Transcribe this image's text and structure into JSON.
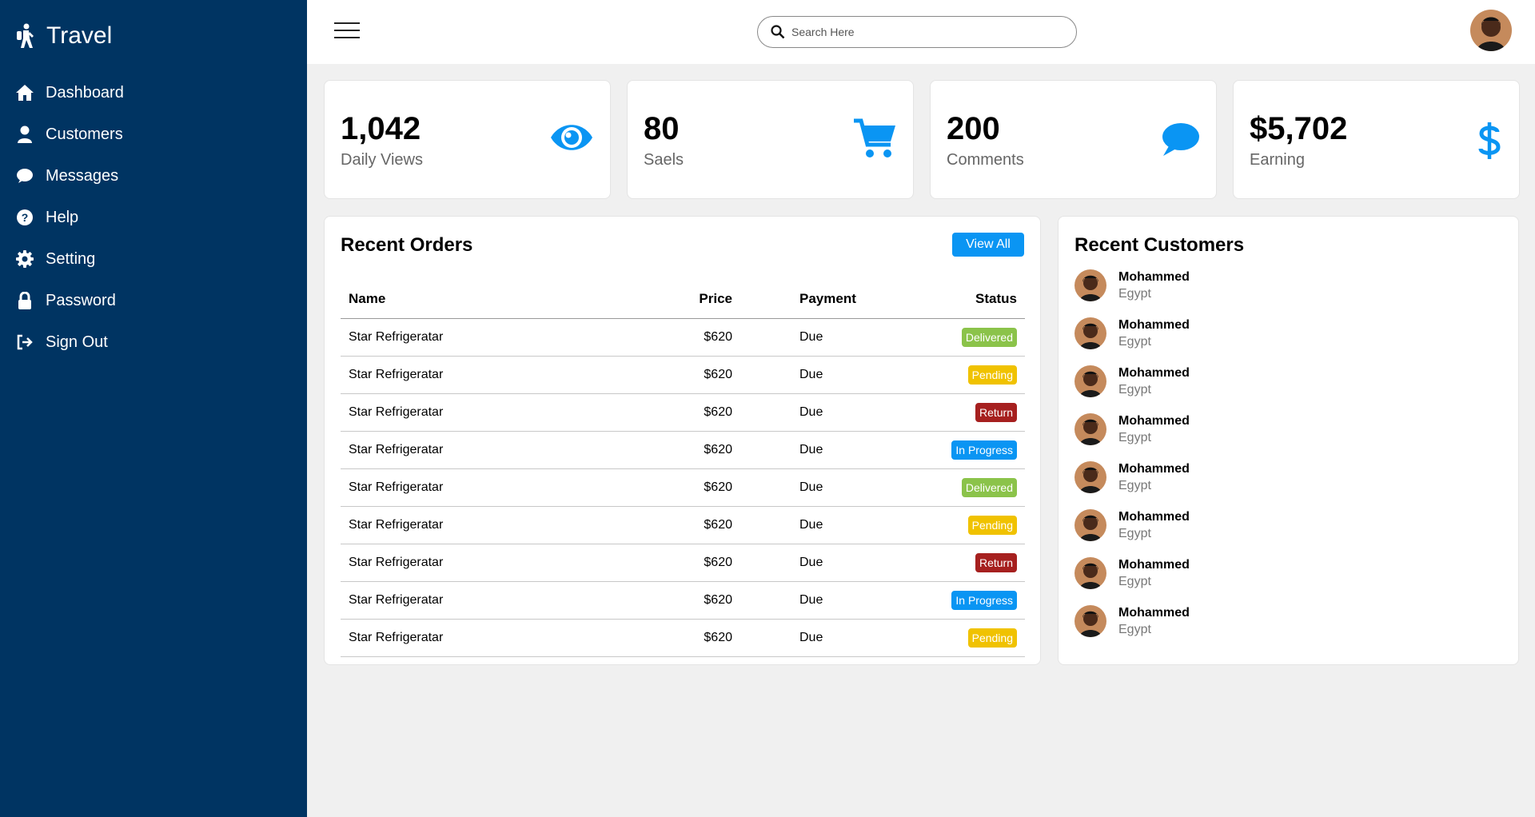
{
  "colors": {
    "sidebar_bg": "#003462",
    "accent": "#0a95f3",
    "delivered": "#8bc34a",
    "pending": "#f0c200",
    "return": "#a6201f",
    "in_progress": "#0a95f3"
  },
  "sidebar": {
    "brand": {
      "title": "Travel",
      "icon": "hiker-icon"
    },
    "items": [
      {
        "label": "Dashboard",
        "icon": "home-icon"
      },
      {
        "label": "Customers",
        "icon": "user-icon"
      },
      {
        "label": "Messages",
        "icon": "chat-icon"
      },
      {
        "label": "Help",
        "icon": "help-icon"
      },
      {
        "label": "Setting",
        "icon": "gear-icon"
      },
      {
        "label": "Password",
        "icon": "lock-icon"
      },
      {
        "label": "Sign Out",
        "icon": "sign-out-icon"
      }
    ]
  },
  "topbar": {
    "search_placeholder": "Search Here",
    "menu_icon": "hamburger-icon",
    "search_icon": "search-icon"
  },
  "cards": [
    {
      "number": "1,042",
      "caption": "Daily Views",
      "icon": "eye-icon"
    },
    {
      "number": "80",
      "caption": "Saels",
      "icon": "cart-icon"
    },
    {
      "number": "200",
      "caption": "Comments",
      "icon": "comment-icon"
    },
    {
      "number": "$5,702",
      "caption": "Earning",
      "icon": "dollar-icon"
    }
  ],
  "orders": {
    "title": "Recent Orders",
    "view_all": "View All",
    "headers": [
      "Name",
      "Price",
      "Payment",
      "Status"
    ],
    "rows": [
      {
        "name": "Star Refrigeratar",
        "price": "$620",
        "payment": "Due",
        "status": "Delivered",
        "status_type": "delivered"
      },
      {
        "name": "Star Refrigeratar",
        "price": "$620",
        "payment": "Due",
        "status": "Pending",
        "status_type": "pending"
      },
      {
        "name": "Star Refrigeratar",
        "price": "$620",
        "payment": "Due",
        "status": "Return",
        "status_type": "return"
      },
      {
        "name": "Star Refrigeratar",
        "price": "$620",
        "payment": "Due",
        "status": "In Progress",
        "status_type": "in_progress"
      },
      {
        "name": "Star Refrigeratar",
        "price": "$620",
        "payment": "Due",
        "status": "Delivered",
        "status_type": "delivered"
      },
      {
        "name": "Star Refrigeratar",
        "price": "$620",
        "payment": "Due",
        "status": "Pending",
        "status_type": "pending"
      },
      {
        "name": "Star Refrigeratar",
        "price": "$620",
        "payment": "Due",
        "status": "Return",
        "status_type": "return"
      },
      {
        "name": "Star Refrigeratar",
        "price": "$620",
        "payment": "Due",
        "status": "In Progress",
        "status_type": "in_progress"
      },
      {
        "name": "Star Refrigeratar",
        "price": "$620",
        "payment": "Due",
        "status": "Pending",
        "status_type": "pending"
      }
    ]
  },
  "customers": {
    "title": "Recent Customers",
    "list": [
      {
        "name": "Mohammed",
        "country": "Egypt"
      },
      {
        "name": "Mohammed",
        "country": "Egypt"
      },
      {
        "name": "Mohammed",
        "country": "Egypt"
      },
      {
        "name": "Mohammed",
        "country": "Egypt"
      },
      {
        "name": "Mohammed",
        "country": "Egypt"
      },
      {
        "name": "Mohammed",
        "country": "Egypt"
      },
      {
        "name": "Mohammed",
        "country": "Egypt"
      },
      {
        "name": "Mohammed",
        "country": "Egypt"
      }
    ]
  }
}
